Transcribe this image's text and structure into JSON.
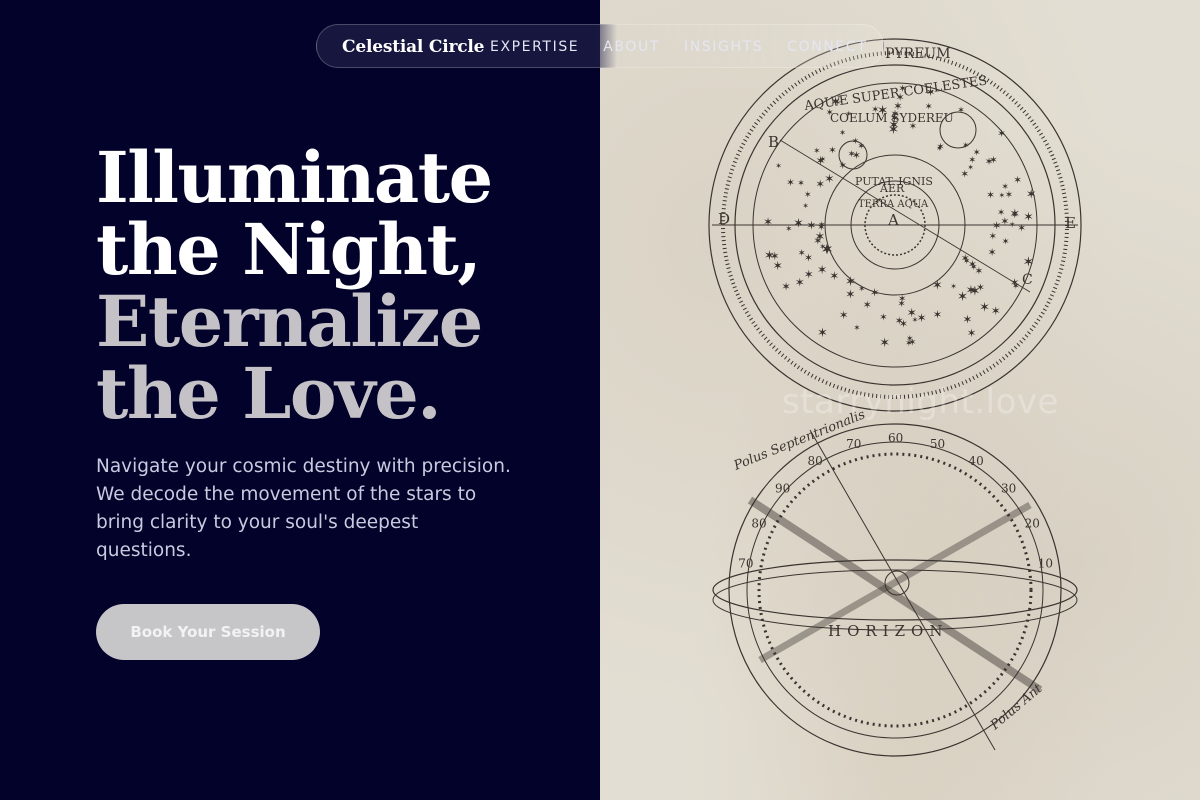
{
  "nav": {
    "brand": "Celestial Circle",
    "links": [
      "EXPERTISE",
      "ABOUT",
      "INSIGHTS",
      "CONNECT"
    ]
  },
  "hero": {
    "line1": "Illuminate",
    "line2": "the Night,",
    "line3": "Eternalize",
    "line4": "the Love.",
    "subtitle": "Navigate your cosmic destiny with precision. We decode the movement of the stars to bring clarity to your soul's deepest questions.",
    "cta_label": "Book Your Session"
  },
  "illustration": {
    "watermark": "starrynight.love",
    "upper_labels": {
      "pyreum": "PYREUM",
      "aquae": "AQUÆ SUPER COELESTES",
      "coelum": "COELUM SYDEREU",
      "putat": "PUTAT. IGNIS",
      "aer": "AER",
      "terra": "TERRA AQUA",
      "center": "A",
      "b": "B",
      "c": "C",
      "d": "D",
      "e": "E"
    },
    "lower_labels": {
      "polus_sep": "Polus Septentrionalis",
      "polus_ant": "Polus Ant",
      "horizon": "HORIZON",
      "ring_numbers": [
        "70",
        "80",
        "90",
        "80",
        "70",
        "60",
        "50",
        "40",
        "30",
        "20",
        "10"
      ]
    }
  },
  "colors": {
    "left_bg": "#02022a",
    "paper": "#e3ded3",
    "ink": "#3a3430",
    "cta_bg": "#c6c5c8",
    "subtitle": "#c9cadf"
  }
}
